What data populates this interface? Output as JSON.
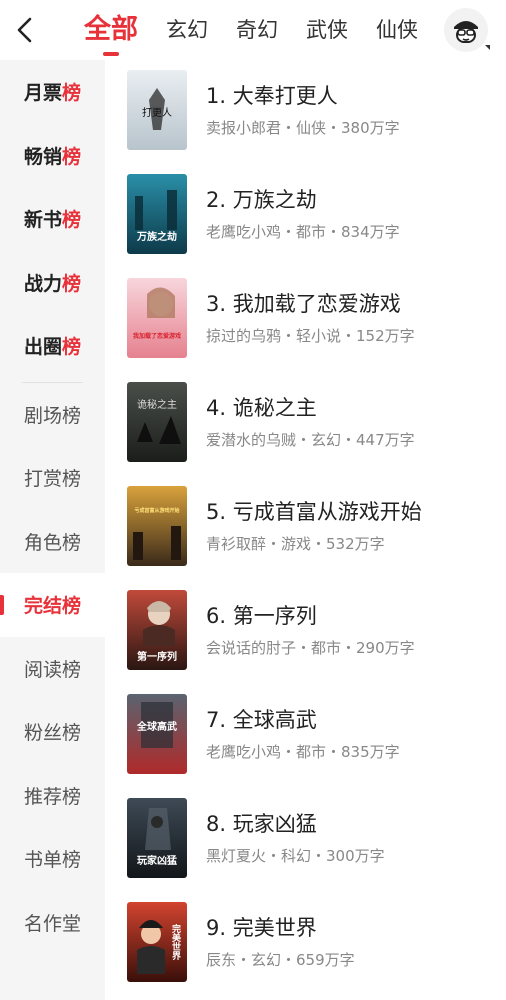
{
  "tabs": [
    "全部",
    "玄幻",
    "奇幻",
    "武侠",
    "仙侠"
  ],
  "sidebar": [
    {
      "main": "月票",
      "suffix": "榜"
    },
    {
      "main": "畅销",
      "suffix": "榜"
    },
    {
      "main": "新书",
      "suffix": "榜"
    },
    {
      "main": "战力",
      "suffix": "榜"
    },
    {
      "main": "出圈",
      "suffix": "榜"
    },
    {
      "label": "剧场榜"
    },
    {
      "label": "打赏榜"
    },
    {
      "label": "角色榜"
    },
    {
      "label": "完结榜"
    },
    {
      "label": "阅读榜"
    },
    {
      "label": "粉丝榜"
    },
    {
      "label": "推荐榜"
    },
    {
      "label": "书单榜"
    },
    {
      "label": "名作堂"
    }
  ],
  "books": [
    {
      "title": "1. 大奉打更人",
      "meta": "卖报小郎君・仙侠・380万字",
      "cover_text": "打更人",
      "cover_colors": [
        "#e9eef2",
        "#b8c4cc"
      ]
    },
    {
      "title": "2. 万族之劫",
      "meta": "老鹰吃小鸡・都市・834万字",
      "cover_text": "万族之劫",
      "cover_colors": [
        "#2a8fa8",
        "#0d3a4a"
      ]
    },
    {
      "title": "3. 我加载了恋爱游戏",
      "meta": "掠过的乌鸦・轻小说・152万字",
      "cover_text": "我加载了恋爱游戏",
      "cover_colors": [
        "#f7d6dc",
        "#e6818f"
      ]
    },
    {
      "title": "4. 诡秘之主",
      "meta": "爱潜水的乌贼・玄幻・447万字",
      "cover_text": "诡秘之主",
      "cover_colors": [
        "#4a4f4a",
        "#1b1d1b"
      ]
    },
    {
      "title": "5. 亏成首富从游戏开始",
      "meta": "青衫取醉・游戏・532万字",
      "cover_text": "亏成首富从游戏开始",
      "cover_colors": [
        "#d9a23c",
        "#3a2a1a"
      ]
    },
    {
      "title": "6. 第一序列",
      "meta": "会说话的肘子・都市・290万字",
      "cover_text": "第一序列",
      "cover_colors": [
        "#c04a3a",
        "#2a1612"
      ]
    },
    {
      "title": "7. 全球高武",
      "meta": "老鹰吃小鸡・都市・835万字",
      "cover_text": "全球高武",
      "cover_colors": [
        "#5a6470",
        "#b02a2a"
      ]
    },
    {
      "title": "8. 玩家凶猛",
      "meta": "黑灯夏火・科幻・300万字",
      "cover_text": "玩家凶猛",
      "cover_colors": [
        "#3e4a55",
        "#12161a"
      ]
    },
    {
      "title": "9. 完美世界",
      "meta": "辰东・玄幻・659万字",
      "cover_text": "完美世界",
      "cover_colors": [
        "#d2432f",
        "#3a0f0a"
      ]
    }
  ],
  "colors": {
    "accent": "#e8323a",
    "sidebar_bg": "#f5f5f5"
  }
}
